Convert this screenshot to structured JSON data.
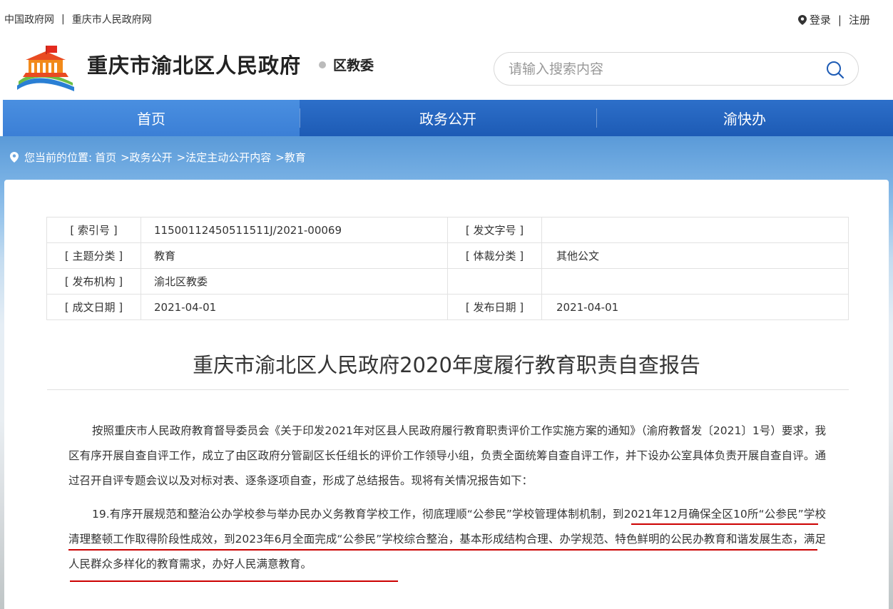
{
  "top_links": [
    "中国政府网",
    "重庆市人民政府网"
  ],
  "top_sep": "|",
  "auth": {
    "login": "登录",
    "sep": "|",
    "register": "注册"
  },
  "site": {
    "title": "重庆市渝北区人民政府",
    "subtitle": "区教委"
  },
  "search": {
    "placeholder": "请输入搜索内容",
    "value": ""
  },
  "nav": [
    {
      "label": "首页",
      "active": true
    },
    {
      "label": "政务公开",
      "active": false
    },
    {
      "label": "渝快办",
      "active": false
    }
  ],
  "breadcrumb": {
    "label": "您当前的位置:",
    "items": [
      "首页",
      ">政务公开",
      ">法定主动公开内容",
      ">教育"
    ]
  },
  "meta": {
    "index_label": "[ 索引号 ]",
    "index_value": "11500112450511511J/2021-00069",
    "docno_label": "[ 发文字号 ]",
    "docno_value": "",
    "topic_label": "[ 主题分类 ]",
    "topic_value": "教育",
    "genre_label": "[ 体裁分类 ]",
    "genre_value": "其他公文",
    "org_label": "[ 发布机构 ]",
    "org_value": "渝北区教委",
    "created_label": "[ 成文日期 ]",
    "created_value": "2021-04-01",
    "published_label": "[ 发布日期 ]",
    "published_value": "2021-04-01"
  },
  "document": {
    "title": "重庆市渝北区人民政府2020年度履行教育职责自查报告",
    "para1": "按照重庆市人民政府教育督导委员会《关于印发2021年对区县人民政府履行教育职责评价工作实施方案的通知》（渝府教督发〔2021〕1号）要求，我区有序开展自查自评工作，成立了由区政府分管副区长任组长的评价工作领导小组，负责全面统筹自查自评工作，并下设办公室具体负责开展自查自评。通过召开自评专题会议以及对标对表、逐条逐项自查，形成了总结报告。现将有关情况报告如下：",
    "para2": "19.有序开展规范和整治公办学校参与举办民办义务教育学校工作，彻底理顺“公参民”学校管理体制机制，到2021年12月确保全区10所“公参民”学校清理整顿工作取得阶段性成效，到2023年6月全面完成“公参民”学校综合整治，基本形成结构合理、办学规范、特色鲜明的公民办教育和谐发展生态，满足人民群众多样化的教育需求，办好人民满意教育。"
  },
  "colors": {
    "nav": "#1d5bb5",
    "nav_active": "#3b7fd6",
    "underline": "#cc0000"
  }
}
